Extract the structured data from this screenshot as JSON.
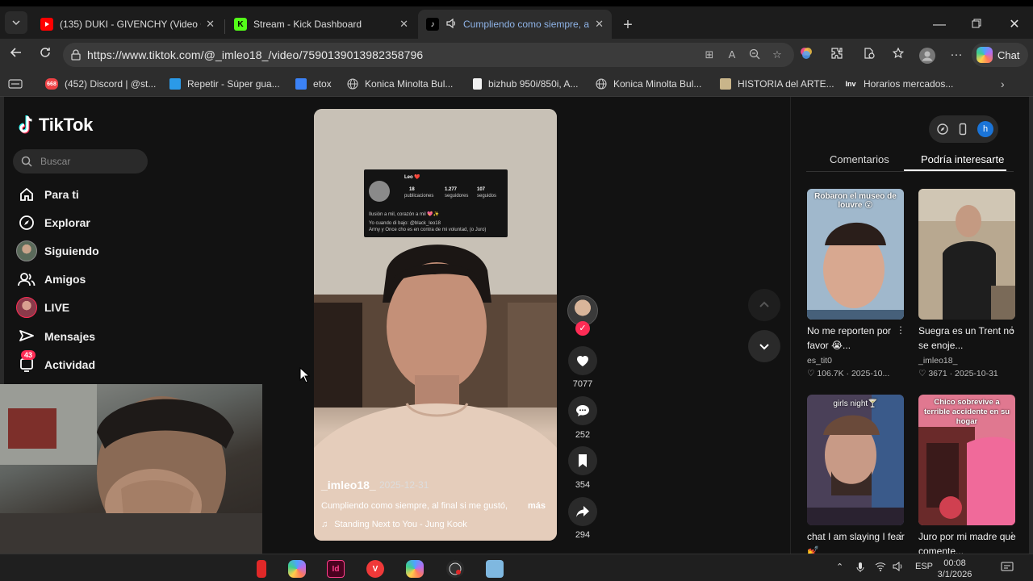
{
  "browser": {
    "tabs": [
      {
        "title": "(135) DUKI - GIVENCHY (Video Ofi",
        "favicon": "youtube-icon",
        "color": "#ff0000",
        "active": false
      },
      {
        "title": "Stream - Kick Dashboard",
        "favicon": "kick-icon",
        "color": "#53fc18",
        "active": false
      },
      {
        "title": "Cumpliendo como siempre, a",
        "favicon": "tiktok-icon",
        "color": "#ffffff",
        "active": true,
        "audio": true
      }
    ],
    "url": "https://www.tiktok.com/@_imleo18_/video/7590139013982358796",
    "copilot_label": "Chat",
    "bookmarks": [
      {
        "label": "(452) Discord | @st...",
        "icon": "discord-icon",
        "badge": "668"
      },
      {
        "label": "Repetir - Súper gua...",
        "icon": "tutorial-icon"
      },
      {
        "label": "etox",
        "icon": "lock-bookmark-icon"
      },
      {
        "label": "Konica Minolta Bul...",
        "icon": "globe-icon"
      },
      {
        "label": "bizhub 950i/850i, A...",
        "icon": "doc-icon"
      },
      {
        "label": "Konica Minolta Bul...",
        "icon": "globe-icon"
      },
      {
        "label": "HISTORIA del ARTE...",
        "icon": "image-icon"
      },
      {
        "label": "Horarios mercados...",
        "icon": "inv-icon"
      }
    ]
  },
  "tiktok": {
    "logo": "TikTok",
    "search_placeholder": "Buscar",
    "nav": [
      {
        "label": "Para ti",
        "icon": "home-icon"
      },
      {
        "label": "Explorar",
        "icon": "compass-icon"
      },
      {
        "label": "Siguiendo",
        "icon": "avatar-icon"
      },
      {
        "label": "Amigos",
        "icon": "friends-icon"
      },
      {
        "label": "LIVE",
        "icon": "live-avatar-icon"
      },
      {
        "label": "Mensajes",
        "icon": "send-icon"
      },
      {
        "label": "Actividad",
        "icon": "activity-icon",
        "badge": "43"
      }
    ],
    "video": {
      "username": "_imleo18_",
      "date": "2025-12-31",
      "caption": "Cumpliendo como siempre, al final si me gustó,",
      "more": "más",
      "music": "Standing Next to You - Jung Kook",
      "overlay_card": {
        "name": "Leo ❤️",
        "stats": [
          {
            "value": "18",
            "label": "publicaciones"
          },
          {
            "value": "1.277",
            "label": "seguidores"
          },
          {
            "value": "107",
            "label": "seguidos"
          }
        ],
        "bio1": "Ilusión a mil, corazón a mil 💖✨",
        "bio2": "Yo cuando di bajo: @black_leo18",
        "bio3": "Army y Once cho es en contra de mi voluntad, (o Juro)"
      }
    },
    "actions": [
      {
        "icon": "heart-icon",
        "count": "7077"
      },
      {
        "icon": "comment-icon",
        "count": "252"
      },
      {
        "icon": "bookmark-icon",
        "count": "354"
      },
      {
        "icon": "share-icon",
        "count": "294"
      }
    ],
    "right_tabs": [
      "Comentarios",
      "Podría interesarte"
    ],
    "suggestions": [
      {
        "overlay": "Robaron el museo de louvre 😮",
        "caption": "No me reporten por favor 😭...",
        "author": "es_tit0",
        "likes": "106.7K",
        "date": "2025-10...",
        "bg": "#6f8aa6"
      },
      {
        "overlay": "",
        "caption": "Suegra es un Trent no se enoje...",
        "author": "_imleo18_",
        "likes": "3671",
        "date": "2025-10-31",
        "bg": "#8a7d6c"
      },
      {
        "overlay": "girls night🍸",
        "caption": "chat I am slaying I fear 💅",
        "author": "",
        "likes": "",
        "date": "",
        "bg": "#7a6a8a"
      },
      {
        "overlay": "Chico sobrevive a terrible accidente en su hogar",
        "caption": "Juro por mi madre que comente...",
        "author": "",
        "likes": "",
        "date": "",
        "bg": "#c2566e"
      }
    ]
  },
  "taskbar": {
    "language": "ESP",
    "time": "00:08",
    "date": "3/1/2026"
  },
  "colors": {
    "accent": "#fe2c55",
    "tiktok_cyan": "#25f4ee"
  }
}
